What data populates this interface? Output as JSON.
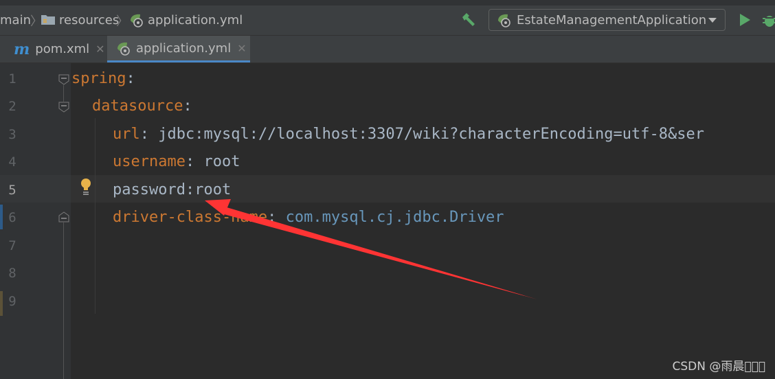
{
  "breadcrumb": {
    "items": [
      "main",
      "resources",
      "application.yml"
    ]
  },
  "run_config": {
    "name": "EstateManagementApplication"
  },
  "tabs": [
    {
      "label": "pom.xml",
      "icon": "maven-m-icon",
      "active": false
    },
    {
      "label": "application.yml",
      "icon": "spring-yml-icon",
      "active": true
    }
  ],
  "editor": {
    "current_line": 5,
    "line_numbers": [
      "1",
      "2",
      "3",
      "4",
      "5",
      "6",
      "7",
      "8",
      "9"
    ],
    "lines": [
      {
        "key": "spring",
        "colon": ":",
        "value": ""
      },
      {
        "key": "datasource",
        "colon": ":",
        "value": ""
      },
      {
        "key": "url",
        "colon": ":",
        "value": " jdbc:mysql://localhost:3307/wiki?characterEncoding=utf-8&ser"
      },
      {
        "key": "username",
        "colon": ":",
        "value": " root"
      },
      {
        "key": "",
        "colon": "",
        "value": "password:root"
      },
      {
        "key": "driver-class-name",
        "colon": ":",
        "value": " com.mysql.cj.jdbc.Driver"
      }
    ]
  },
  "colors": {
    "background": "#2b2b2b",
    "key": "#cc7832",
    "value": "#a9b7c6",
    "class_value": "#6897bb",
    "arrow": "#ff3030",
    "accent": "#4a88c7"
  },
  "watermark": "CSDN @雨晨\u0000\u0000\u0000"
}
